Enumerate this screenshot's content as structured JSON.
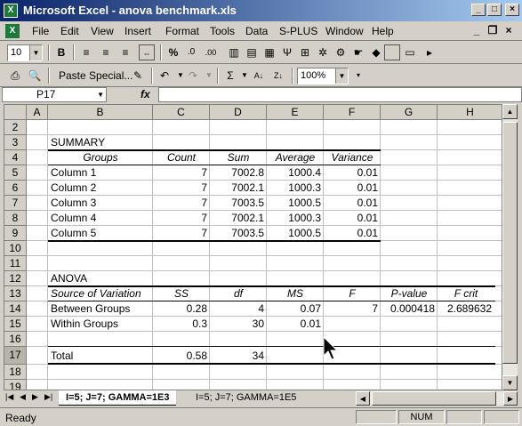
{
  "window": {
    "title": "Microsoft Excel - anova benchmark.xls",
    "app_icon": "X"
  },
  "menu": {
    "items": [
      "File",
      "Edit",
      "View",
      "Insert",
      "Format",
      "Tools",
      "Data",
      "S-PLUS",
      "Window",
      "Help"
    ]
  },
  "toolbar": {
    "font_size": "10",
    "paste_special_label": "Paste Special...",
    "zoom": "100%"
  },
  "formula_bar": {
    "name_box": "P17",
    "fx_label": "fx",
    "formula": ""
  },
  "columns": [
    "A",
    "B",
    "C",
    "D",
    "E",
    "F",
    "G",
    "H"
  ],
  "rows": [
    "2",
    "3",
    "4",
    "5",
    "6",
    "7",
    "8",
    "9",
    "10",
    "11",
    "12",
    "13",
    "14",
    "15",
    "16",
    "17",
    "18",
    "19"
  ],
  "summary": {
    "title": "SUMMARY",
    "headers": [
      "Groups",
      "Count",
      "Sum",
      "Average",
      "Variance"
    ],
    "rows": [
      [
        "Column 1",
        "7",
        "7002.8",
        "1000.4",
        "0.01"
      ],
      [
        "Column 2",
        "7",
        "7002.1",
        "1000.3",
        "0.01"
      ],
      [
        "Column 3",
        "7",
        "7003.5",
        "1000.5",
        "0.01"
      ],
      [
        "Column 4",
        "7",
        "7002.1",
        "1000.3",
        "0.01"
      ],
      [
        "Column 5",
        "7",
        "7003.5",
        "1000.5",
        "0.01"
      ]
    ]
  },
  "anova": {
    "title": "ANOVA",
    "headers": [
      "Source of Variation",
      "SS",
      "df",
      "MS",
      "F",
      "P-value",
      "F crit"
    ],
    "between": [
      "Between Groups",
      "0.28",
      "4",
      "0.07",
      "7",
      "0.000418",
      "2.689632"
    ],
    "within": [
      "Within Groups",
      "0.3",
      "30",
      "0.01"
    ],
    "total": [
      "Total",
      "0.58",
      "34"
    ]
  },
  "sheet_tabs": {
    "active": "I=5; J=7; GAMMA=1E3",
    "other": "I=5; J=7; GAMMA=1E5"
  },
  "status": {
    "ready": "Ready",
    "num": "NUM"
  }
}
